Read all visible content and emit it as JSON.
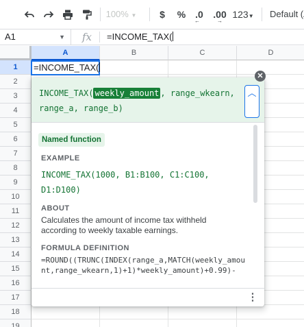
{
  "toolbar": {
    "zoom": "100%",
    "currency": "$",
    "percent": "%",
    "decrease_decimals": ".0",
    "increase_decimals": ".00",
    "number_format": "123",
    "font": "Default (A"
  },
  "formula_bar": {
    "name_box": "A1",
    "fx": "fx",
    "formula": "=INCOME_TAX("
  },
  "columns": [
    "A",
    "B",
    "C",
    "D"
  ],
  "rows": [
    "1",
    "2",
    "3",
    "4",
    "5",
    "6",
    "7",
    "8",
    "9",
    "10",
    "11",
    "12",
    "13",
    "14",
    "15",
    "16",
    "17",
    "18",
    "19"
  ],
  "active_cell": {
    "value": "=INCOME_TAX("
  },
  "formula_help": {
    "signature_name": "INCOME_TAX(",
    "signature_active_arg": "weekly_amount",
    "signature_rest": ", range_wkearn, range_a, range_b)",
    "badge": "Named function",
    "example_title": "EXAMPLE",
    "example_code": "INCOME_TAX(1000, B1:B100, C1:C100, D1:D100)",
    "about_title": "ABOUT",
    "about_text": "Calculates the amount of income tax withheld according to weekly taxable earnings.",
    "definition_title": "FORMULA DEFINITION",
    "definition_code": "=ROUND((TRUNC(INDEX(range_a,MATCH(weekly_amount,range_wkearn,1)+1)*weekly_amount)+0.99)-"
  },
  "colors": {
    "accent": "#1a73e8",
    "green": "#137333",
    "green_bg": "#e6f4ea"
  }
}
